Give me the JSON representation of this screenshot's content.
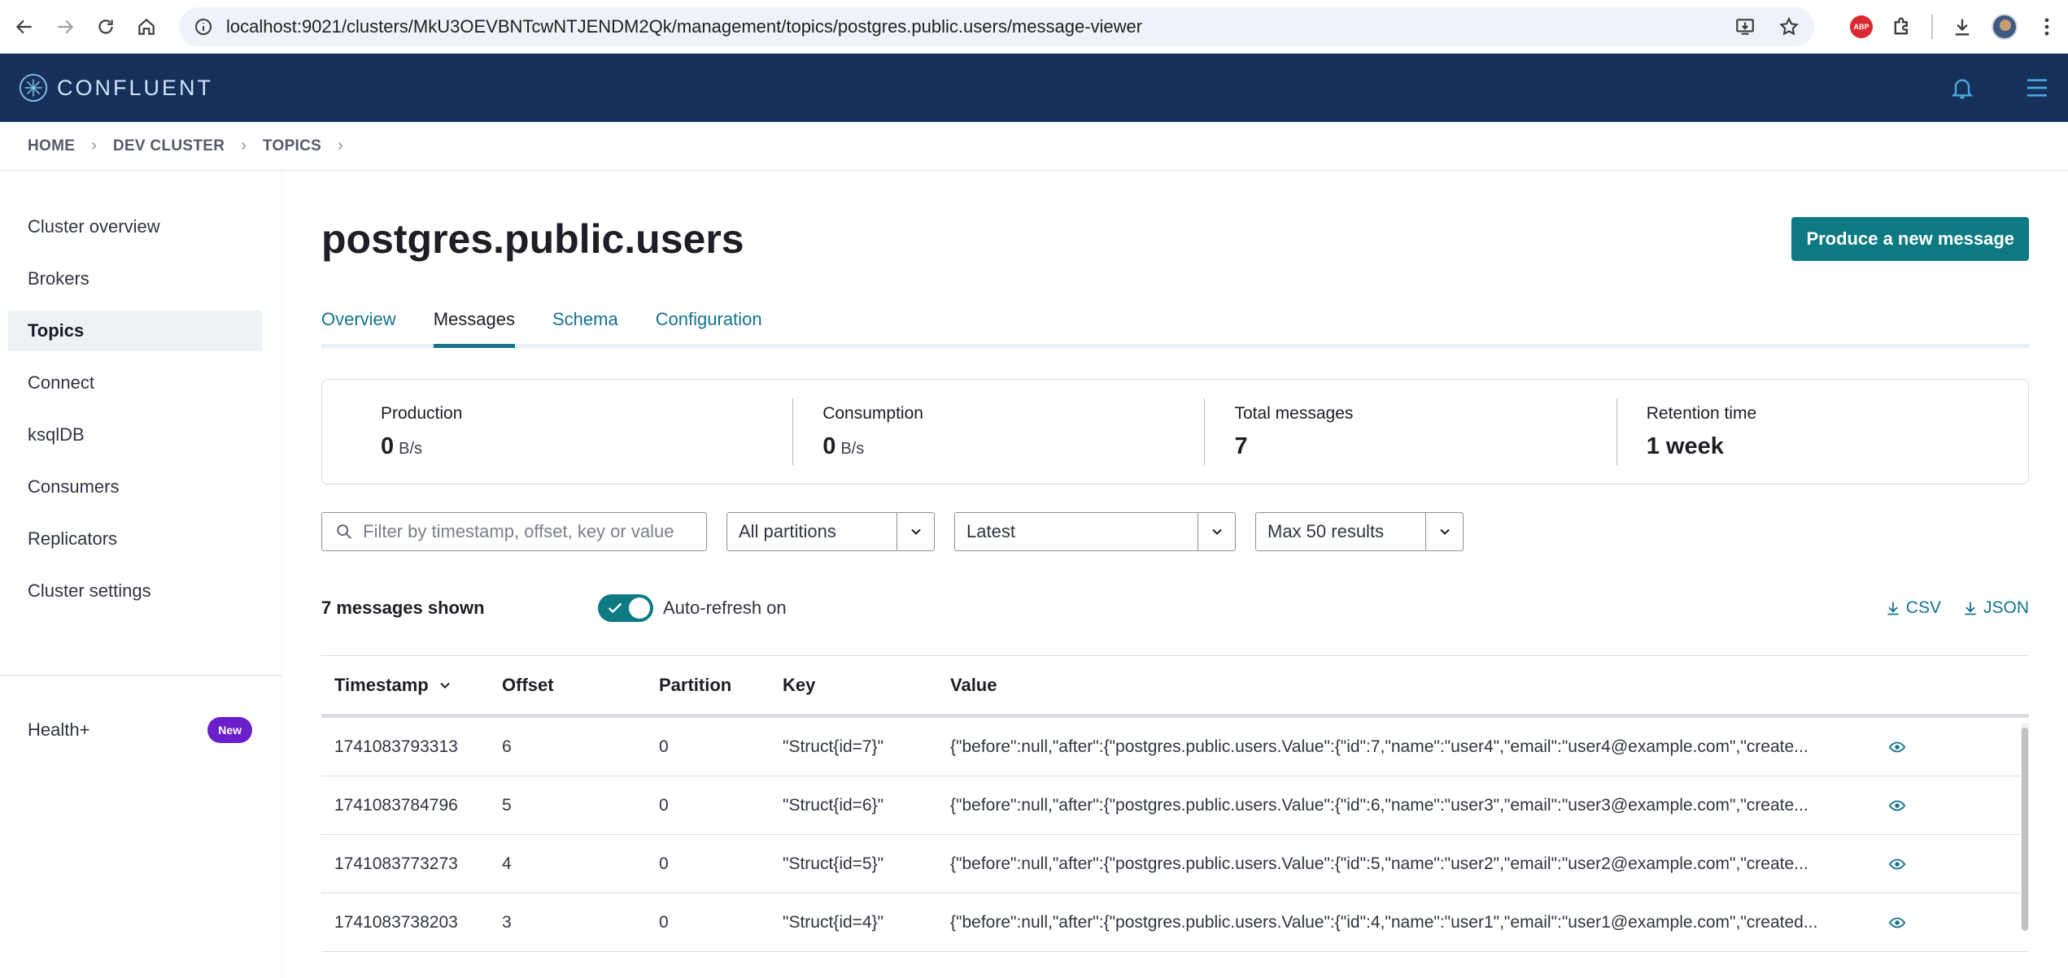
{
  "browser": {
    "url": "localhost:9021/clusters/MkU3OEVBNTcwNTJENDM2Qk/management/topics/postgres.public.users/message-viewer"
  },
  "header": {
    "logo_text": "CONFLUENT"
  },
  "breadcrumb": {
    "items": [
      "HOME",
      "DEV CLUSTER",
      "TOPICS"
    ]
  },
  "sidebar": {
    "items": [
      {
        "label": "Cluster overview"
      },
      {
        "label": "Brokers"
      },
      {
        "label": "Topics"
      },
      {
        "label": "Connect"
      },
      {
        "label": "ksqlDB"
      },
      {
        "label": "Consumers"
      },
      {
        "label": "Replicators"
      },
      {
        "label": "Cluster settings"
      }
    ],
    "active": "Topics",
    "health_label": "Health+",
    "health_badge": "New"
  },
  "main": {
    "title": "postgres.public.users",
    "produce_button": "Produce a new message",
    "tabs": [
      {
        "label": "Overview"
      },
      {
        "label": "Messages"
      },
      {
        "label": "Schema"
      },
      {
        "label": "Configuration"
      }
    ],
    "active_tab": "Messages",
    "stats": [
      {
        "label": "Production",
        "value": "0",
        "unit": "B/s"
      },
      {
        "label": "Consumption",
        "value": "0",
        "unit": "B/s"
      },
      {
        "label": "Total messages",
        "value": "7",
        "unit": ""
      },
      {
        "label": "Retention time",
        "value": "1 week",
        "unit": ""
      }
    ],
    "filters": {
      "search_placeholder": "Filter by timestamp, offset, key or value",
      "partitions": "All partitions",
      "offset_mode": "Latest",
      "max_results": "Max 50 results"
    },
    "messages_shown": "7 messages shown",
    "auto_refresh_label": "Auto-refresh on",
    "auto_refresh_on": true,
    "downloads": [
      "CSV",
      "JSON"
    ],
    "table": {
      "headers": [
        "Timestamp",
        "Offset",
        "Partition",
        "Key",
        "Value"
      ],
      "rows": [
        {
          "timestamp": "1741083793313",
          "offset": "6",
          "partition": "0",
          "key": "\"Struct{id=7}\"",
          "value": "{\"before\":null,\"after\":{\"postgres.public.users.Value\":{\"id\":7,\"name\":\"user4\",\"email\":\"user4@example.com\",\"create..."
        },
        {
          "timestamp": "1741083784796",
          "offset": "5",
          "partition": "0",
          "key": "\"Struct{id=6}\"",
          "value": "{\"before\":null,\"after\":{\"postgres.public.users.Value\":{\"id\":6,\"name\":\"user3\",\"email\":\"user3@example.com\",\"create..."
        },
        {
          "timestamp": "1741083773273",
          "offset": "4",
          "partition": "0",
          "key": "\"Struct{id=5}\"",
          "value": "{\"before\":null,\"after\":{\"postgres.public.users.Value\":{\"id\":5,\"name\":\"user2\",\"email\":\"user2@example.com\",\"create..."
        },
        {
          "timestamp": "1741083738203",
          "offset": "3",
          "partition": "0",
          "key": "\"Struct{id=4}\"",
          "value": "{\"before\":null,\"after\":{\"postgres.public.users.Value\":{\"id\":4,\"name\":\"user1\",\"email\":\"user1@example.com\",\"created..."
        }
      ]
    }
  },
  "colors": {
    "header_bg": "#17305a",
    "primary": "#0d7a83",
    "link": "#14738d",
    "badge": "#6b1fcb"
  }
}
